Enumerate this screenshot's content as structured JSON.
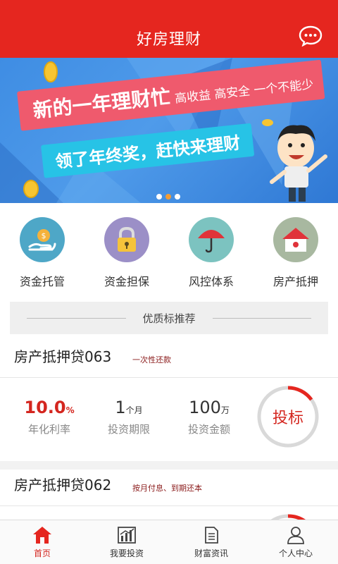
{
  "header": {
    "title": "好房理财",
    "chat_icon": "chat-bubble-icon"
  },
  "banner": {
    "line1": "新的一年理财忙",
    "line1_sub": "高收益 高安全 一个不能少",
    "line2": "领了年终奖，赶快来理财",
    "page_count": 3,
    "active_page": 2
  },
  "features": [
    {
      "label": "资金托管",
      "icon": "money-hand-icon",
      "color": "#4ea7c7"
    },
    {
      "label": "资金担保",
      "icon": "padlock-icon",
      "color": "#9b8fc7"
    },
    {
      "label": "风控体系",
      "icon": "umbrella-icon",
      "color": "#7cc3c0"
    },
    {
      "label": "房产抵押",
      "icon": "house-icon",
      "color": "#a8b8a0"
    }
  ],
  "section": {
    "title": "优质标推荐"
  },
  "products": [
    {
      "name": "房产抵押贷063",
      "tag": "一次性还款",
      "rate": "10.0",
      "rate_unit": "%",
      "rate_caption": "年化利率",
      "term": "1",
      "term_unit": "个月",
      "term_caption": "投资期限",
      "amount": "100",
      "amount_unit": "万",
      "amount_caption": "投资金额",
      "button": "投标",
      "progress": 0.15
    },
    {
      "name": "房产抵押贷062",
      "tag": "按月付息、到期还本"
    }
  ],
  "tabbar": [
    {
      "label": "首页",
      "icon": "home-icon",
      "active": true
    },
    {
      "label": "我要投资",
      "icon": "bar-chart-icon",
      "active": false
    },
    {
      "label": "财富资讯",
      "icon": "document-icon",
      "active": false
    },
    {
      "label": "个人中心",
      "icon": "user-icon",
      "active": false
    }
  ],
  "colors": {
    "brand": "#e5261f",
    "accent_red": "#d4261f",
    "dot_active": "#f39c34"
  }
}
